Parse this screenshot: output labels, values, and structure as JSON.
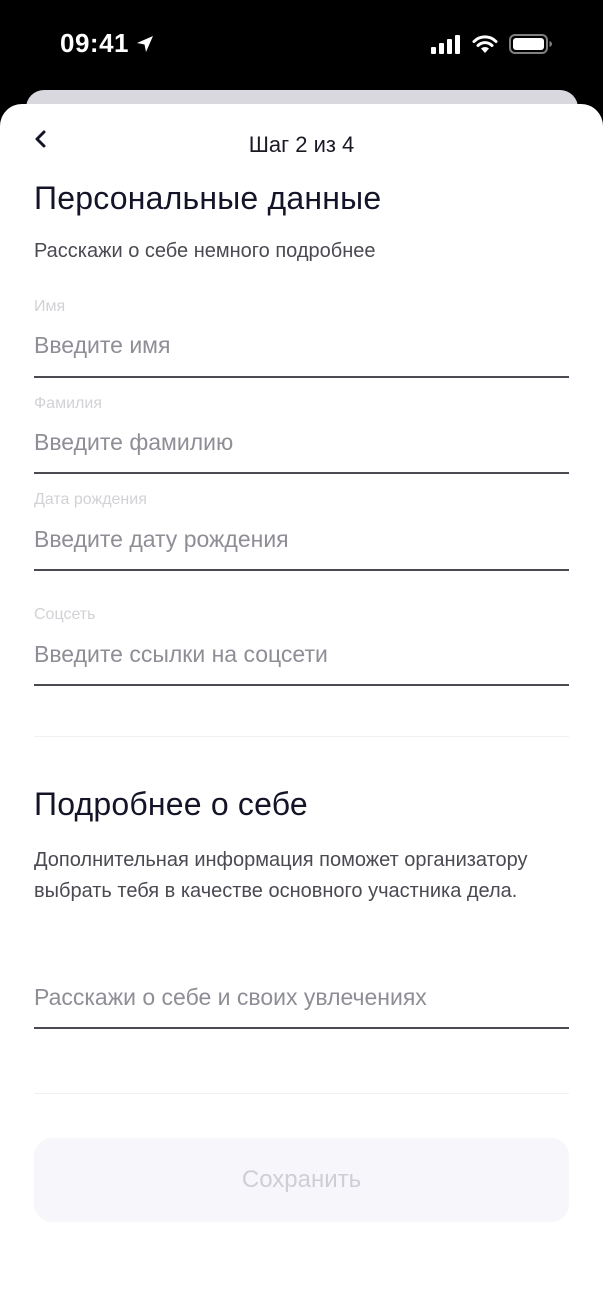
{
  "status_bar": {
    "time": "09:41",
    "icons": [
      "location-arrow-icon",
      "cellular-signal-icon",
      "wifi-icon",
      "battery-icon"
    ]
  },
  "header": {
    "back_icon": "chevron-left-icon",
    "step": "Шаг 2 из 4"
  },
  "personal": {
    "title": "Персональные данные",
    "subtitle": "Расскажи о себе немного подробнее",
    "fields": [
      {
        "label": "Имя",
        "placeholder": "Введите имя",
        "value": ""
      },
      {
        "label": "Фамилия",
        "placeholder": "Введите фамилию",
        "value": ""
      },
      {
        "label": "Дата рождения",
        "placeholder": "Введите дату рождения",
        "value": ""
      },
      {
        "label": "Соцсеть",
        "placeholder": "Введите ссылки на соцсети",
        "value": ""
      }
    ]
  },
  "about": {
    "title": "Подробнее о себе",
    "description": "Дополнительная информация поможет организатору выбрать тебя в качестве основного участника дела.",
    "placeholder": "Расскажи о себе и своих увлечениях",
    "value": ""
  },
  "save_button": {
    "label": "Сохранить",
    "state": "disabled"
  },
  "colors": {
    "sheet_background": "#ffffff",
    "heading": "#141428",
    "placeholder": "#8e8e96",
    "label": "#d2d2d6",
    "underline": "#4a4a50",
    "button_background": "#f7f6fa",
    "button_text_disabled": "#cfced6"
  }
}
